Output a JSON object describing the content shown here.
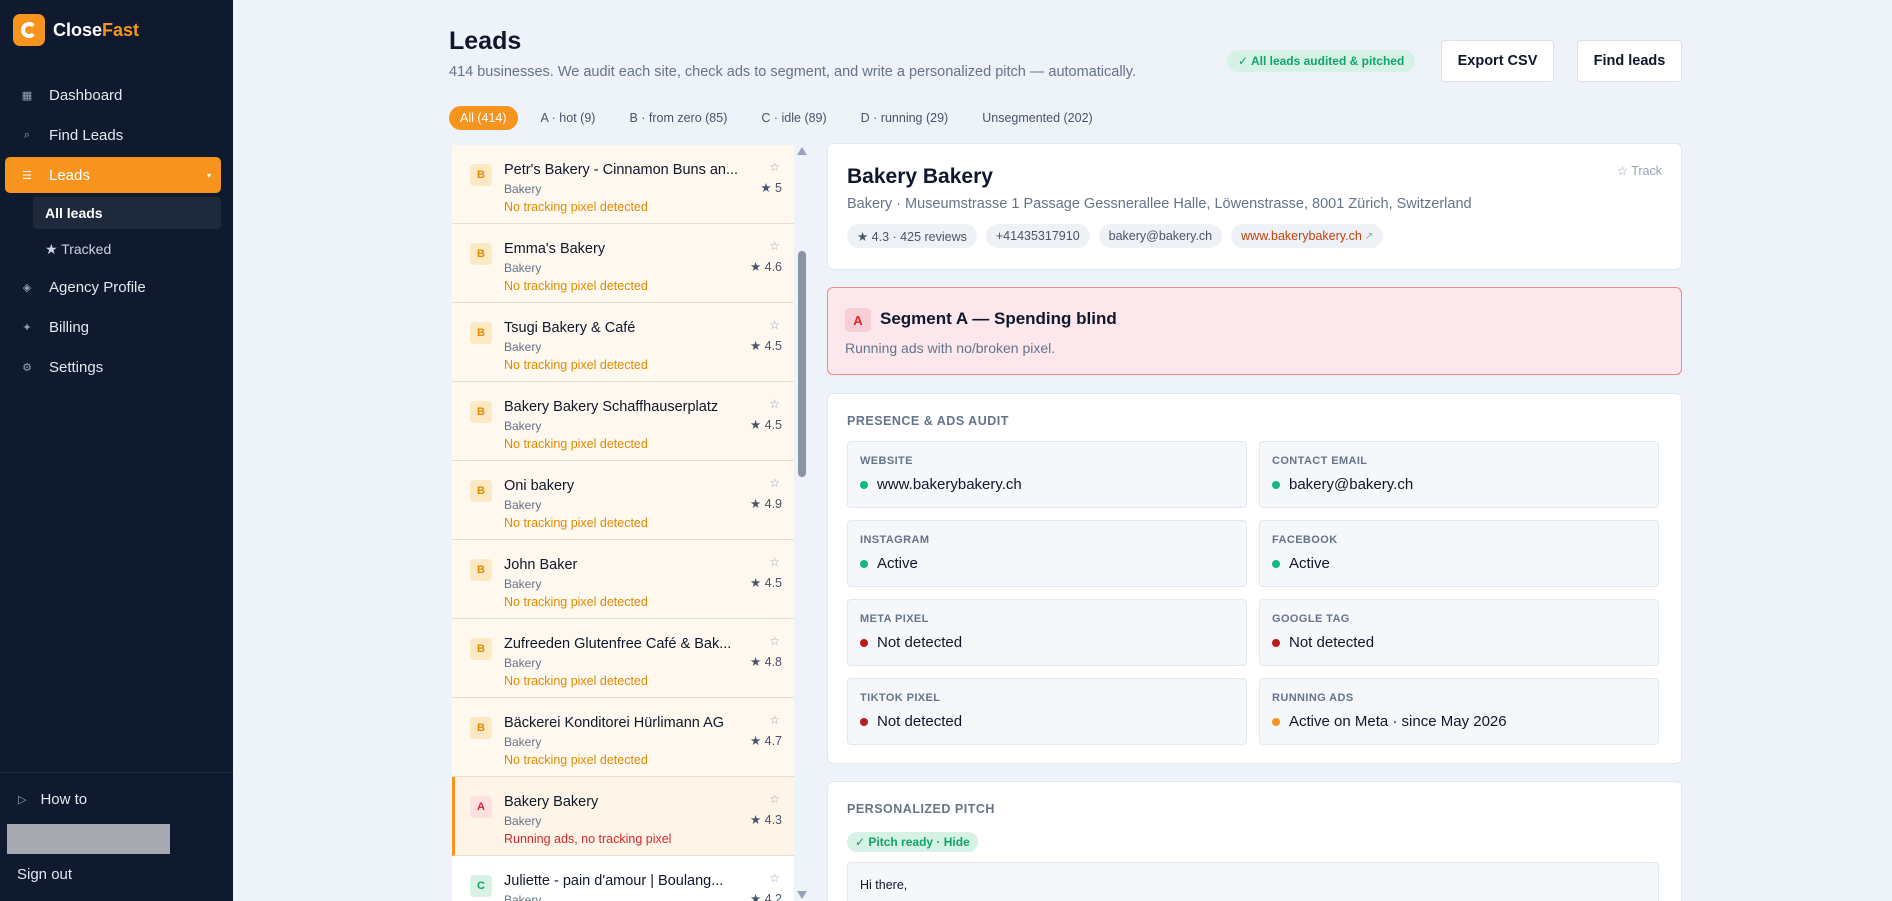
{
  "brand": {
    "name_part1": "Close",
    "name_part2": "Fast",
    "logo_icon": "closefast-logo-icon",
    "brand_color": "#f7941d"
  },
  "sidebar": {
    "nav": [
      {
        "label": "Dashboard",
        "icon": "grid-icon"
      },
      {
        "label": "Find Leads",
        "icon": "search-icon"
      },
      {
        "label": "Leads",
        "icon": "list-icon",
        "active": true
      },
      {
        "label": "Agency Profile",
        "icon": "diamond-icon"
      },
      {
        "label": "Billing",
        "icon": "sparkle-icon"
      },
      {
        "label": "Settings",
        "icon": "gear-icon"
      }
    ],
    "leads_sub": [
      {
        "label": "All leads",
        "active": true
      },
      {
        "label": "★ Tracked"
      }
    ],
    "howto": "How to",
    "signout": "Sign out"
  },
  "header": {
    "title": "Leads",
    "subtitle": "414 businesses. We audit each site, check ads to segment, and write a personalized pitch — automatically.",
    "audit_badge": "✓ All leads audited & pitched",
    "export_button": "Export CSV",
    "find_button": "Find leads"
  },
  "filters": [
    {
      "label": "All (414)",
      "active": true
    },
    {
      "label": "A · hot (9)"
    },
    {
      "label": "B · from zero (85)"
    },
    {
      "label": "C · idle (89)"
    },
    {
      "label": "D · running (29)"
    },
    {
      "label": "Unsegmented (202)"
    }
  ],
  "leads": [
    {
      "segment": "B",
      "name": "Petr's Bakery - Cinnamon Buns an...",
      "category": "Bakery",
      "note": "No tracking pixel detected",
      "rating": "★ 5"
    },
    {
      "segment": "B",
      "name": "Emma's Bakery",
      "category": "Bakery",
      "note": "No tracking pixel detected",
      "rating": "★ 4.6"
    },
    {
      "segment": "B",
      "name": "Tsugi Bakery & Café",
      "category": "Bakery",
      "note": "No tracking pixel detected",
      "rating": "★ 4.5"
    },
    {
      "segment": "B",
      "name": "Bakery Bakery Schaffhauserplatz",
      "category": "Bakery",
      "note": "No tracking pixel detected",
      "rating": "★ 4.5"
    },
    {
      "segment": "B",
      "name": "Oni bakery",
      "category": "Bakery",
      "note": "No tracking pixel detected",
      "rating": "★ 4.9"
    },
    {
      "segment": "B",
      "name": "John Baker",
      "category": "Bakery",
      "note": "No tracking pixel detected",
      "rating": "★ 4.5"
    },
    {
      "segment": "B",
      "name": "Zufreeden Glutenfree Café & Bak...",
      "category": "Bakery",
      "note": "No tracking pixel detected",
      "rating": "★ 4.8"
    },
    {
      "segment": "B",
      "name": "Bäckerei Konditorei Hürlimann AG",
      "category": "Bakery",
      "note": "No tracking pixel detected",
      "rating": "★ 4.7"
    },
    {
      "segment": "A",
      "name": "Bakery Bakery",
      "category": "Bakery",
      "note": "Running ads, no tracking pixel",
      "rating": "★ 4.3",
      "selected": true
    },
    {
      "segment": "C",
      "name": "Juliette - pain d'amour | Boulang...",
      "category": "Bakery",
      "note": "",
      "rating": "★ 4.2"
    }
  ],
  "detail": {
    "name": "Bakery Bakery",
    "track": "☆ Track",
    "address": "Bakery · Museumstrasse 1 Passage Gessnerallee Halle, Löwenstrasse, 8001 Zürich, Switzerland",
    "pills": {
      "rating": "★ 4.3 · 425 reviews",
      "phone": "+41435317910",
      "email": "bakery@bakery.ch",
      "website": "www.bakerybakery.ch",
      "website_ext": "↗"
    },
    "segment": {
      "letter": "A",
      "title": "Segment A — Spending blind",
      "description": "Running ads with no/broken pixel."
    },
    "audit": {
      "title": "PRESENCE & ADS AUDIT",
      "items": [
        {
          "label": "WEBSITE",
          "value": "www.bakerybakery.ch",
          "status": "green"
        },
        {
          "label": "CONTACT EMAIL",
          "value": "bakery@bakery.ch",
          "status": "green"
        },
        {
          "label": "INSTAGRAM",
          "value": "Active",
          "status": "green"
        },
        {
          "label": "FACEBOOK",
          "value": "Active",
          "status": "green"
        },
        {
          "label": "META PIXEL",
          "value": "Not detected",
          "status": "red"
        },
        {
          "label": "GOOGLE TAG",
          "value": "Not detected",
          "status": "red"
        },
        {
          "label": "TIKTOK PIXEL",
          "value": "Not detected",
          "status": "red"
        },
        {
          "label": "RUNNING ADS",
          "value": "Active on Meta · since May 2026",
          "status": "orange"
        }
      ]
    },
    "pitch": {
      "title": "PERSONALIZED PITCH",
      "status": "✓ Pitch ready · Hide",
      "body": "Hi there,"
    }
  }
}
